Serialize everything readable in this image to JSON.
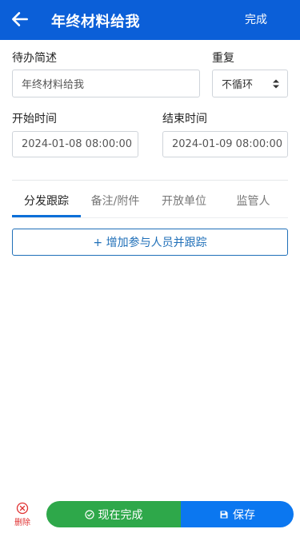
{
  "header": {
    "title": "年终材料给我",
    "done_label": "完成"
  },
  "form": {
    "desc_label": "待办简述",
    "desc_value": "年终材料给我",
    "repeat_label": "重复",
    "repeat_value": "不循环",
    "start_label": "开始时间",
    "start_value": "2024-01-08 08:00:00",
    "end_label": "结束时间",
    "end_value": "2024-01-09 08:00:00"
  },
  "tabs": [
    {
      "label": "分发跟踪",
      "active": true
    },
    {
      "label": "备注/附件",
      "active": false
    },
    {
      "label": "开放单位",
      "active": false
    },
    {
      "label": "监管人",
      "active": false
    }
  ],
  "add_button_label": "+ 增加参与人员并跟踪",
  "footer": {
    "delete_label": "删除",
    "complete_label": "现在完成",
    "save_label": "保存"
  },
  "colors": {
    "header": "#0b5fd8",
    "accent": "#0b77f0",
    "complete": "#2ea84a",
    "danger": "#e03131"
  },
  "icons": {
    "back": "arrow-left-icon",
    "select": "sort-caret-icon",
    "delete": "circle-x-icon",
    "complete": "circle-check-icon",
    "save": "floppy-disk-icon"
  }
}
